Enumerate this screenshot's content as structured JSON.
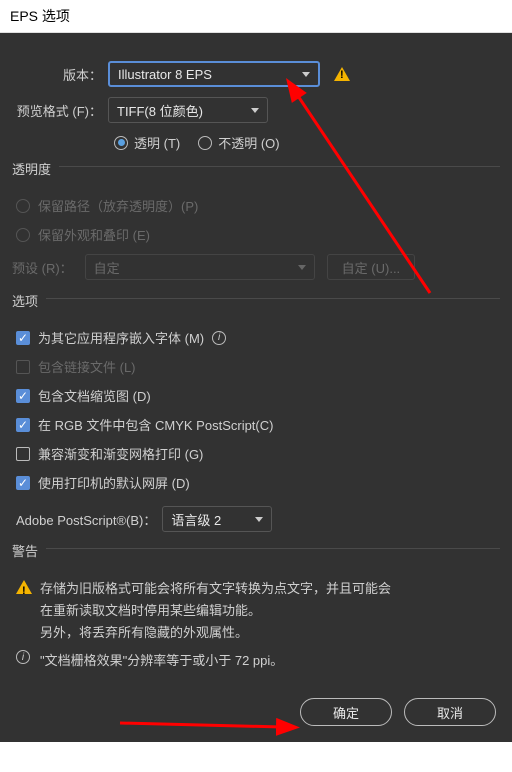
{
  "title": "EPS 选项",
  "version": {
    "label": "版本：",
    "value": "Illustrator 8 EPS"
  },
  "preview": {
    "label": "预览格式 (F)：",
    "value": "TIFF(8 位颜色)",
    "transparent": "透明 (T)",
    "opaque": "不透明 (O)"
  },
  "transparency": {
    "title": "透明度",
    "preservePaths": "保留路径（放弃透明度）(P)",
    "preserveAppearance": "保留外观和叠印 (E)",
    "presetLabel": "预设 (R)：",
    "presetValue": "自定",
    "customBtn": "自定 (U)..."
  },
  "options": {
    "title": "选项",
    "embedFonts": "为其它应用程序嵌入字体 (M)",
    "includeLinked": "包含链接文件 (L)",
    "includeThumbs": "包含文档缩览图 (D)",
    "includeCMYK": "在 RGB 文件中包含 CMYK PostScript(C)",
    "compatGradient": "兼容渐变和渐变网格打印 (G)",
    "usePrinterDefaults": "使用打印机的默认网屏 (D)"
  },
  "postscript": {
    "label": "Adobe PostScript®(B)：",
    "value": "语言级 2"
  },
  "warnings": {
    "title": "警告",
    "line1a": "存储为旧版格式可能会将所有文字转换为点文字，并且可能会",
    "line1b": "在重新读取文档时停用某些编辑功能。",
    "line1c": "另外，将丢弃所有隐藏的外观属性。",
    "line2": "\"文档栅格效果\"分辨率等于或小于 72 ppi。"
  },
  "buttons": {
    "ok": "确定",
    "cancel": "取消"
  }
}
